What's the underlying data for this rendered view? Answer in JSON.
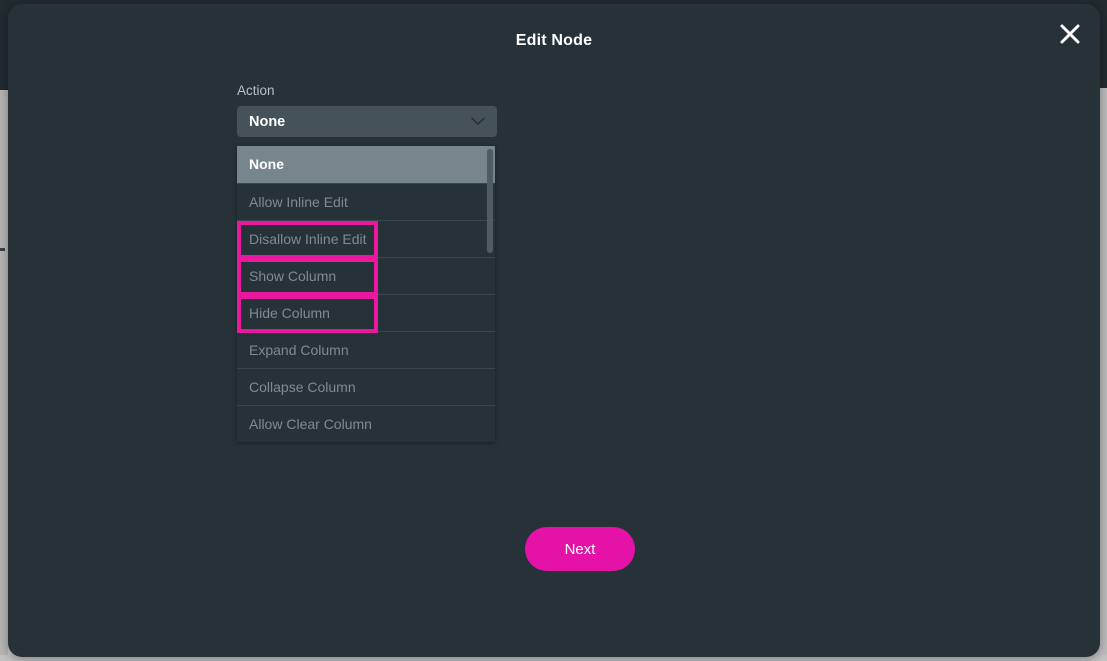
{
  "modal": {
    "title": "Edit Node",
    "close_icon": "close-icon"
  },
  "form": {
    "action_field": {
      "label": "Action",
      "selected_value": "None",
      "chevron_icon": "chevron-down-icon",
      "options": [
        {
          "label": "None",
          "selected": true,
          "highlighted": false
        },
        {
          "label": "Allow Inline Edit",
          "selected": false,
          "highlighted": false
        },
        {
          "label": "Disallow Inline Edit",
          "selected": false,
          "highlighted": true
        },
        {
          "label": "Show Column",
          "selected": false,
          "highlighted": true
        },
        {
          "label": "Hide Column",
          "selected": false,
          "highlighted": true
        },
        {
          "label": "Expand Column",
          "selected": false,
          "highlighted": false
        },
        {
          "label": "Collapse Column",
          "selected": false,
          "highlighted": false
        },
        {
          "label": "Allow Clear Column",
          "selected": false,
          "highlighted": false
        }
      ]
    }
  },
  "footer": {
    "next_label": "Next"
  },
  "colors": {
    "modal_background": "#273238",
    "select_background": "#45525a",
    "option_selected_background": "#77868d",
    "accent_magenta": "#e512a8",
    "annotation_magenta": "#e9189f",
    "text_muted": "#7d8b93",
    "text_primary": "#ffffff"
  }
}
